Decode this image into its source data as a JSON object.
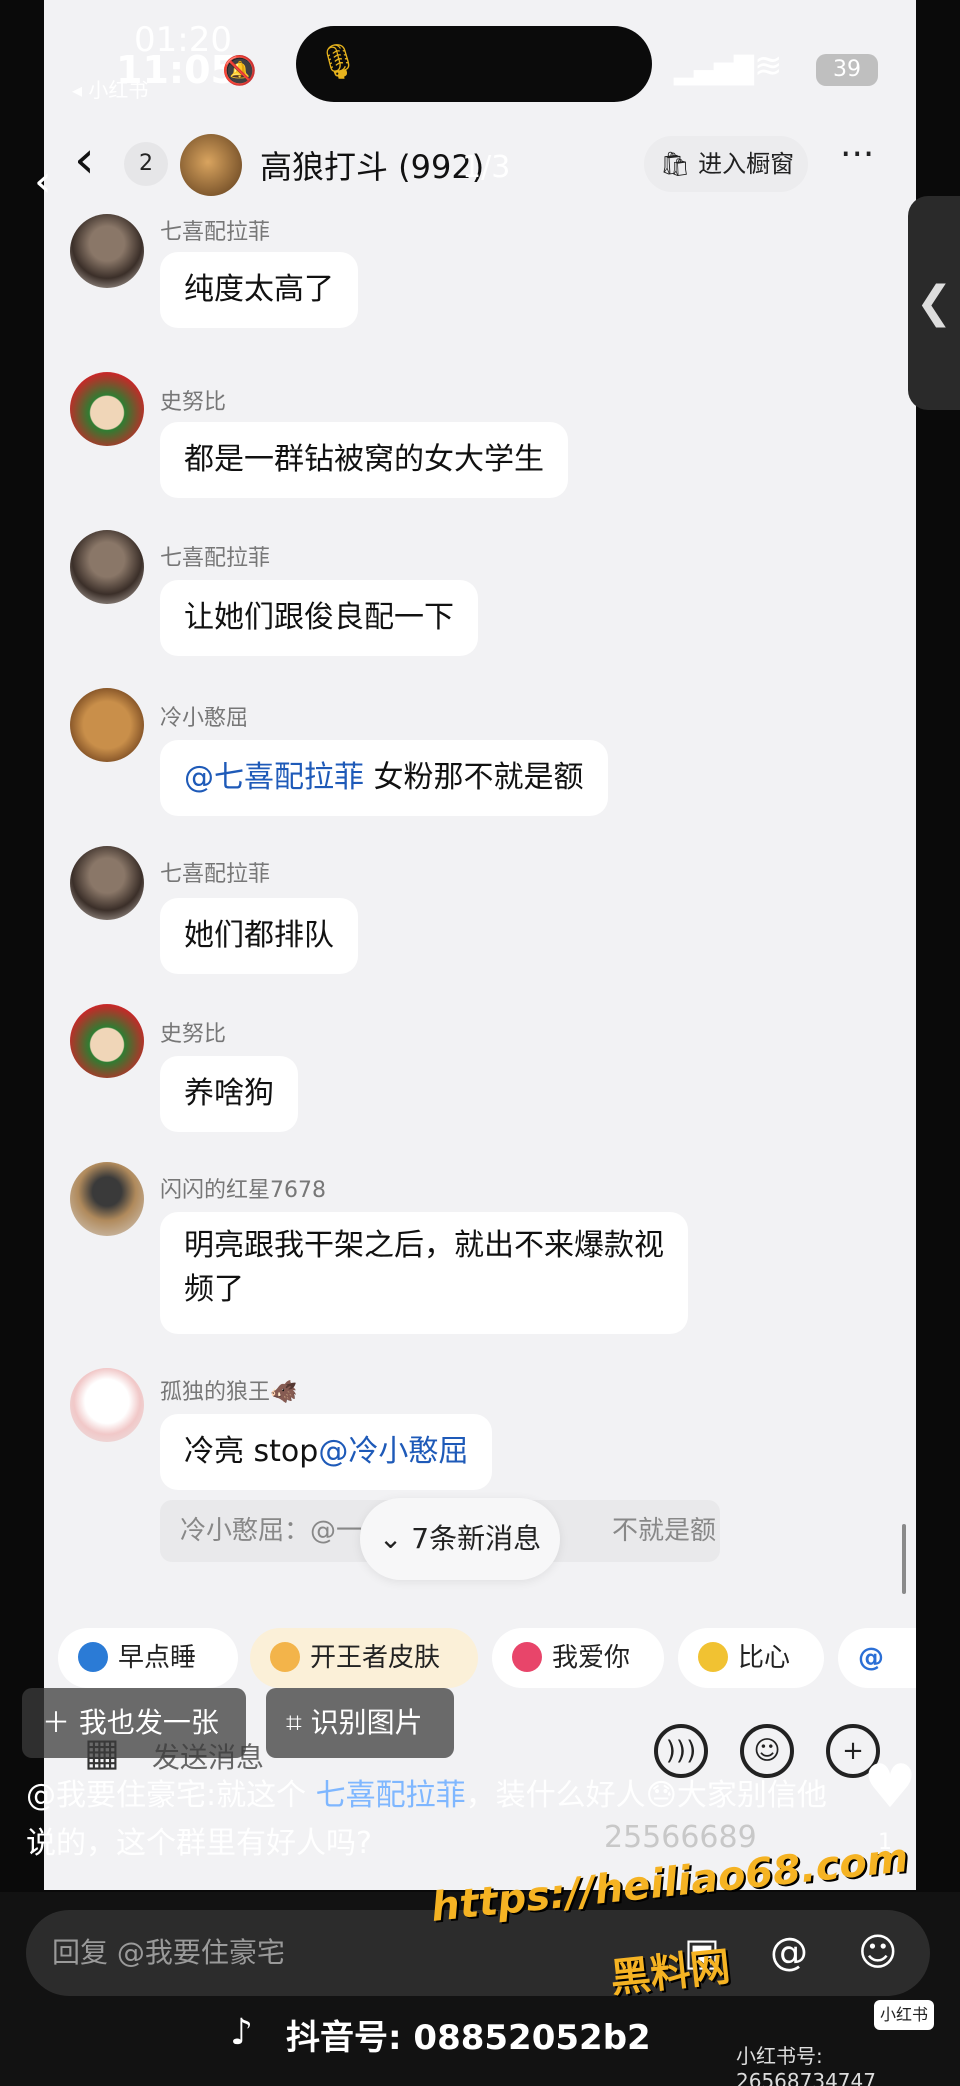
{
  "status_bar": {
    "time_top": "01:20",
    "time_main": "11:05",
    "back_app": "◂ 小红书",
    "battery": "39"
  },
  "chat_header": {
    "unread": "2",
    "title": "高狼打斗 (992)",
    "page_indicator": "1/3",
    "shop_label": "进入橱窗",
    "more": "···"
  },
  "messages": [
    {
      "sender": "七喜配拉菲",
      "text": "纯度太高了"
    },
    {
      "sender": "史努比",
      "text": "都是一群钻被窝的女大学生"
    },
    {
      "sender": "七喜配拉菲",
      "text": "让她们跟俊良配一下"
    },
    {
      "sender": "冷小憨屈",
      "mention": "@七喜配拉菲",
      "text": " 女粉那不就是额"
    },
    {
      "sender": "七喜配拉菲",
      "text": "她们都排队"
    },
    {
      "sender": "史努比",
      "text": "养啥狗"
    },
    {
      "sender": "闪闪的红星7678",
      "text_line1": "明亮跟我干架之后，就出不来爆款视",
      "text_line2": "频了"
    },
    {
      "sender": "孤独的狼王🐗",
      "text": "冷亮 stop",
      "mention": "@冷小憨屈"
    }
  ],
  "quote": {
    "prefix": "冷小憨屈：@一",
    "suffix": "不就是额"
  },
  "new_messages": "7条新消息",
  "quick_replies": [
    "早点睡",
    "开王者皮肤",
    "我爱你",
    "比心",
    "@"
  ],
  "input_placeholder": "发送消息",
  "phone_number_faded": "25566689",
  "post_actions": {
    "share": "我也发一张",
    "recognize": "识别图片"
  },
  "caption": {
    "prefix": "@我要住豪宅:就这个 ",
    "mention": "七喜配拉菲",
    "suffix": "，装什么好人😓大家别信他说的，这个群里有好人吗?"
  },
  "like_count": "1",
  "reply_placeholder": "回复 @我要住豪宅",
  "watermark": {
    "url": "https://heiliao68.com",
    "name": "黑料网"
  },
  "tiktok_id": "抖音号: 08852052b2",
  "xhs": {
    "logo": "小红书",
    "id": "小红书号: 26568734747"
  },
  "colors": {
    "mention": "#1e5ab8",
    "bg": "#f2f2f4",
    "watermark": "#f5b323"
  }
}
